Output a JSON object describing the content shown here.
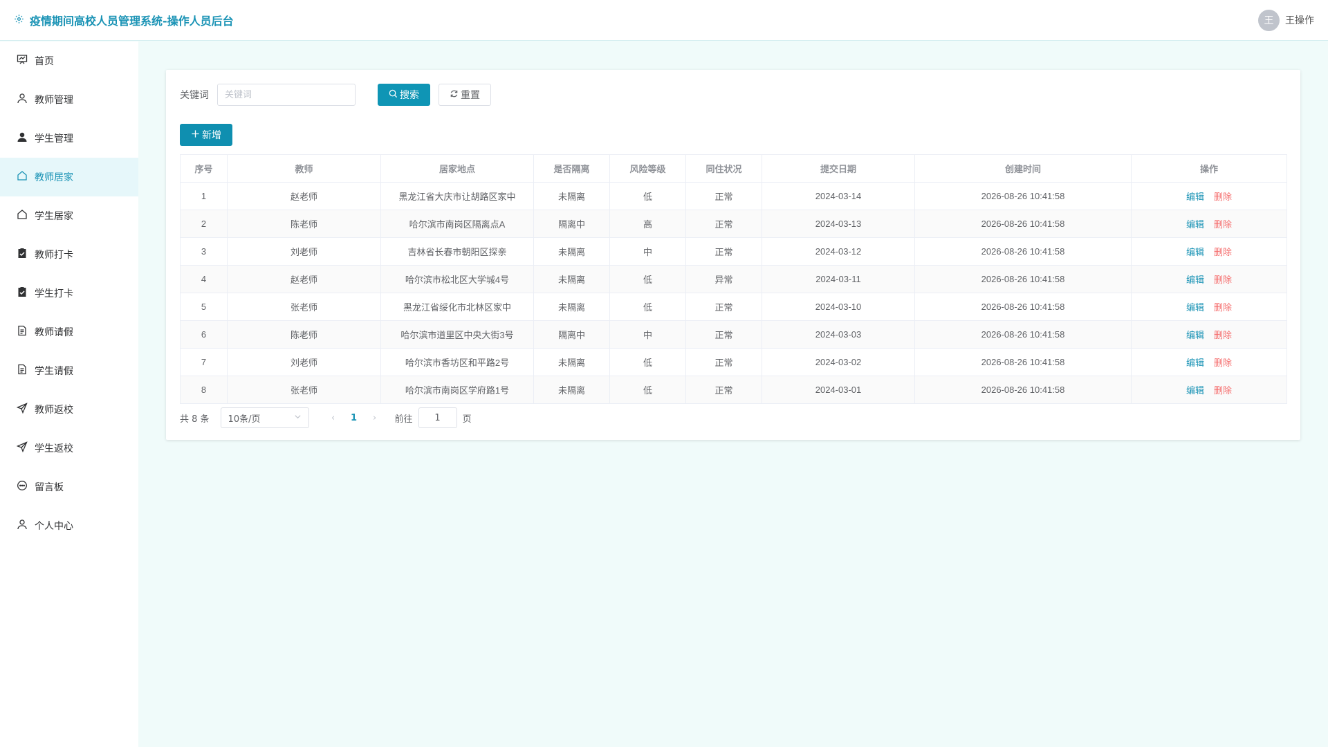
{
  "header": {
    "title": "疫情期间高校人员管理系统-操作人员后台",
    "avatar_char": "王",
    "username": "王操作"
  },
  "sidebar": {
    "items": [
      {
        "label": "首页",
        "icon": "home-board-icon"
      },
      {
        "label": "教师管理",
        "icon": "user-icon"
      },
      {
        "label": "学生管理",
        "icon": "user-filled-icon"
      },
      {
        "label": "教师居家",
        "icon": "house-icon"
      },
      {
        "label": "学生居家",
        "icon": "house-icon"
      },
      {
        "label": "教师打卡",
        "icon": "checklist-icon"
      },
      {
        "label": "学生打卡",
        "icon": "checklist-icon"
      },
      {
        "label": "教师请假",
        "icon": "document-icon"
      },
      {
        "label": "学生请假",
        "icon": "document-icon"
      },
      {
        "label": "教师返校",
        "icon": "send-icon"
      },
      {
        "label": "学生返校",
        "icon": "send-icon"
      },
      {
        "label": "留言板",
        "icon": "chat-icon"
      },
      {
        "label": "个人中心",
        "icon": "user-icon"
      }
    ],
    "active_index": 3
  },
  "search": {
    "label": "关键词",
    "placeholder": "关键词",
    "search_label": "搜索",
    "reset_label": "重置"
  },
  "toolbar": {
    "add_label": "新增"
  },
  "table": {
    "columns": [
      "序号",
      "教师",
      "居家地点",
      "是否隔离",
      "风险等级",
      "同住状况",
      "提交日期",
      "创建时间",
      "操作"
    ],
    "edit_label": "编辑",
    "delete_label": "删除",
    "rows": [
      [
        "1",
        "赵老师",
        "黑龙江省大庆市让胡路区家中",
        "未隔离",
        "低",
        "正常",
        "2024-03-14",
        "2026-08-26 10:41:58"
      ],
      [
        "2",
        "陈老师",
        "哈尔滨市南岗区隔离点A",
        "隔离中",
        "高",
        "正常",
        "2024-03-13",
        "2026-08-26 10:41:58"
      ],
      [
        "3",
        "刘老师",
        "吉林省长春市朝阳区探亲",
        "未隔离",
        "中",
        "正常",
        "2024-03-12",
        "2026-08-26 10:41:58"
      ],
      [
        "4",
        "赵老师",
        "哈尔滨市松北区大学城4号",
        "未隔离",
        "低",
        "异常",
        "2024-03-11",
        "2026-08-26 10:41:58"
      ],
      [
        "5",
        "张老师",
        "黑龙江省绥化市北林区家中",
        "未隔离",
        "低",
        "正常",
        "2024-03-10",
        "2026-08-26 10:41:58"
      ],
      [
        "6",
        "陈老师",
        "哈尔滨市道里区中央大街3号",
        "隔离中",
        "中",
        "正常",
        "2024-03-03",
        "2026-08-26 10:41:58"
      ],
      [
        "7",
        "刘老师",
        "哈尔滨市香坊区和平路2号",
        "未隔离",
        "低",
        "正常",
        "2024-03-02",
        "2026-08-26 10:41:58"
      ],
      [
        "8",
        "张老师",
        "哈尔滨市南岗区学府路1号",
        "未隔离",
        "低",
        "正常",
        "2024-03-01",
        "2026-08-26 10:41:58"
      ]
    ]
  },
  "pager": {
    "total": "共 8 条",
    "page_size": "10条/页",
    "current_page": "1",
    "goto_prefix": "前往",
    "goto_value": "1",
    "goto_suffix": "页"
  },
  "colors": {
    "accent": "#1a93b5",
    "danger": "#f56c6c",
    "background": "#f0fbfa"
  }
}
